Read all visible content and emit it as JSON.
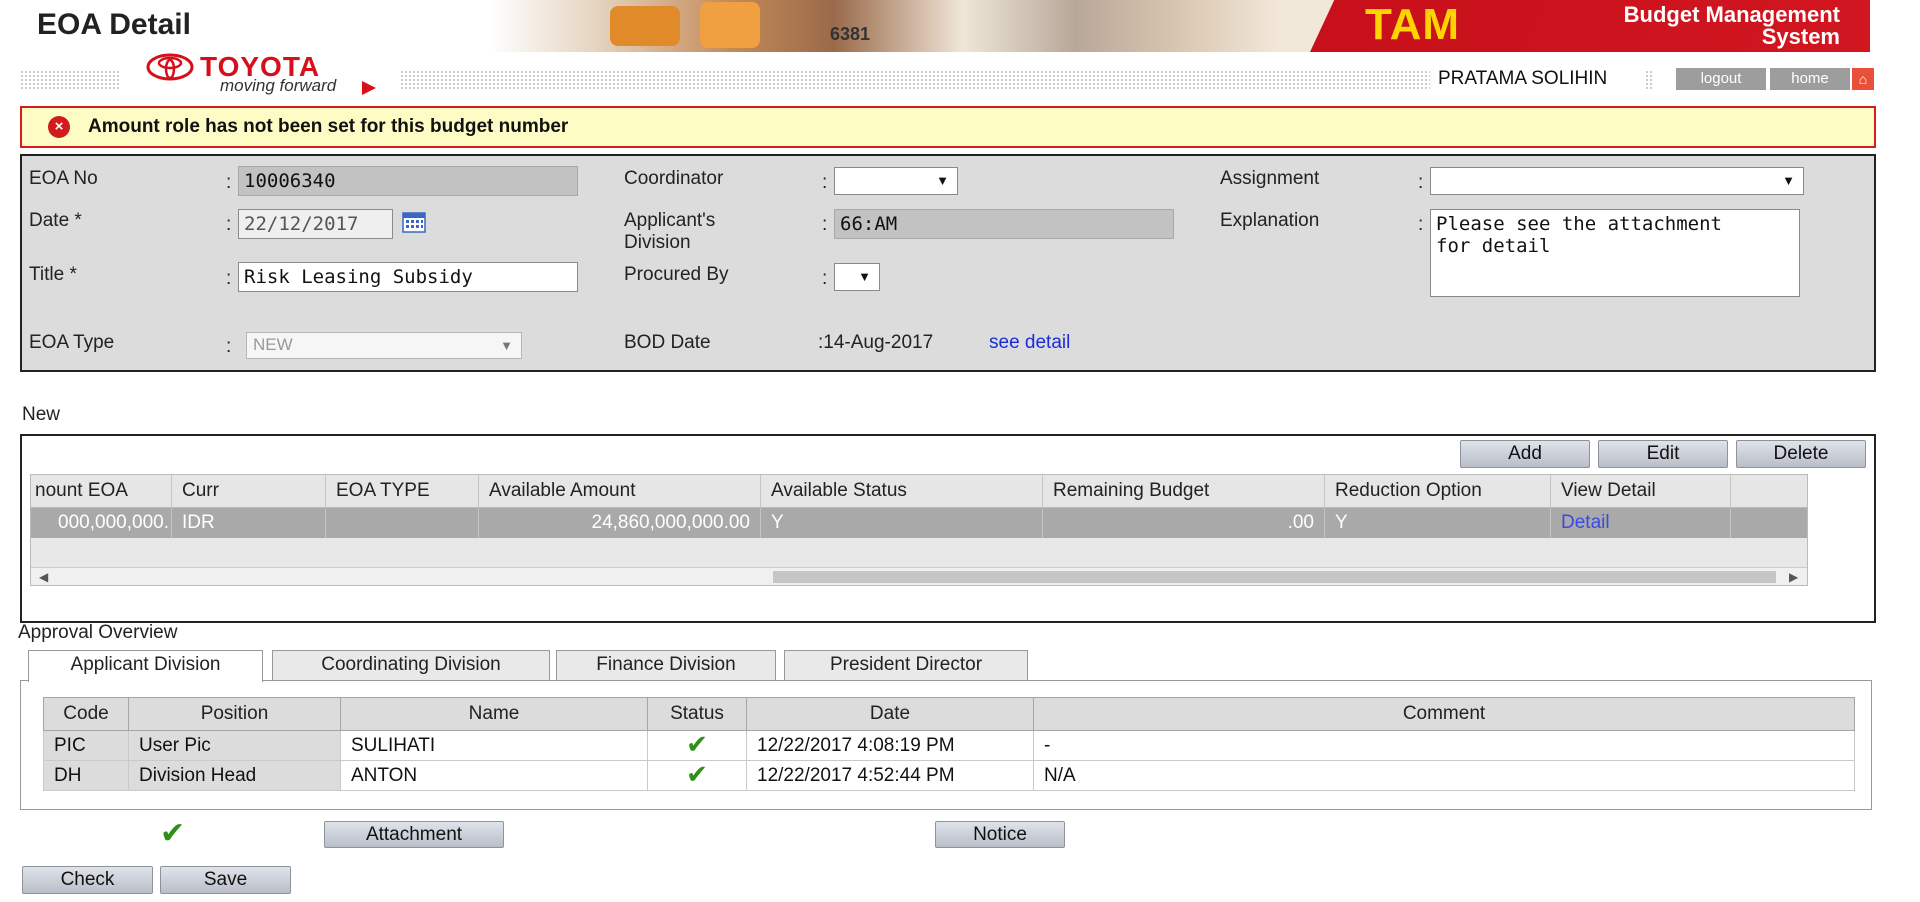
{
  "header": {
    "title": "EOA Detail",
    "banner_number": "6381",
    "system_short": "TAM",
    "system_name_line1": "Budget Management",
    "system_name_line2": "System",
    "logo_word": "TOYOTA",
    "logo_tagline": "moving forward",
    "user_name": "PRATAMA SOLIHIN",
    "logout_label": "logout",
    "home_label": "home"
  },
  "error": {
    "message": "Amount role has not been set for this budget number"
  },
  "form": {
    "eoa_no_label": "EOA No",
    "eoa_no_value": "10006340",
    "date_label": "Date *",
    "date_value": "22/12/2017",
    "title_label": "Title *",
    "title_value": "Risk Leasing Subsidy",
    "eoa_type_label": "EOA Type",
    "eoa_type_value": "NEW",
    "coordinator_label": "Coordinator",
    "coordinator_value": "",
    "applicant_division_label_1": "Applicant's",
    "applicant_division_label_2": "Division",
    "applicant_division_value": "66:AM",
    "procured_by_label": "Procured By",
    "procured_by_value": "",
    "bod_date_label": "BOD Date",
    "bod_date_value": ":14-Aug-2017",
    "see_detail_link": "see detail",
    "assignment_label": "Assignment",
    "assignment_value": "",
    "explanation_label": "Explanation",
    "explanation_value": "Please see the attachment\nfor detail",
    "colon": ":"
  },
  "new_section": {
    "label": "New",
    "add_label": "Add",
    "edit_label": "Edit",
    "delete_label": "Delete",
    "columns": [
      "nount EOA",
      "Curr",
      "EOA TYPE",
      "Available Amount",
      "Available Status",
      "Remaining Budget",
      "Reduction Option",
      "View Detail"
    ],
    "row": {
      "amount_eoa": "000,000,000.",
      "curr": "IDR",
      "eoa_type": "",
      "available_amount": "24,860,000,000.00",
      "available_status": "Y",
      "remaining_budget": ".00",
      "reduction_option": "Y",
      "view_detail": "Detail"
    }
  },
  "approval": {
    "label": "Approval Overview",
    "tabs": [
      "Applicant Division",
      "Coordinating Division",
      "Finance Division",
      "President Director"
    ],
    "active_tab": "Applicant Division",
    "columns": [
      "Code",
      "Position",
      "Name",
      "Status",
      "Date",
      "Comment"
    ],
    "rows": [
      {
        "code": "PIC",
        "position": "User Pic",
        "name": "SULIHATI",
        "status": "approved",
        "date": "12/22/2017 4:08:19 PM",
        "comment": "-"
      },
      {
        "code": "DH",
        "position": "Division Head",
        "name": "ANTON",
        "status": "approved",
        "date": "12/22/2017 4:52:44 PM",
        "comment": "N/A"
      }
    ]
  },
  "actions": {
    "attachment_label": "Attachment",
    "notice_label": "Notice",
    "check_label": "Check",
    "save_label": "Save"
  },
  "colors": {
    "error_border": "#d41e1e",
    "error_background": "#fcfcc4",
    "brand_red": "#d6101a",
    "tam_yellow": "#ffd400",
    "link_blue": "#1a2cd8",
    "approved_green": "#2f8f1a"
  },
  "icons": {
    "error": "error-circle-x-icon",
    "calendar": "calendar-icon",
    "status": "checkmark-icon",
    "home": "home-icon"
  }
}
